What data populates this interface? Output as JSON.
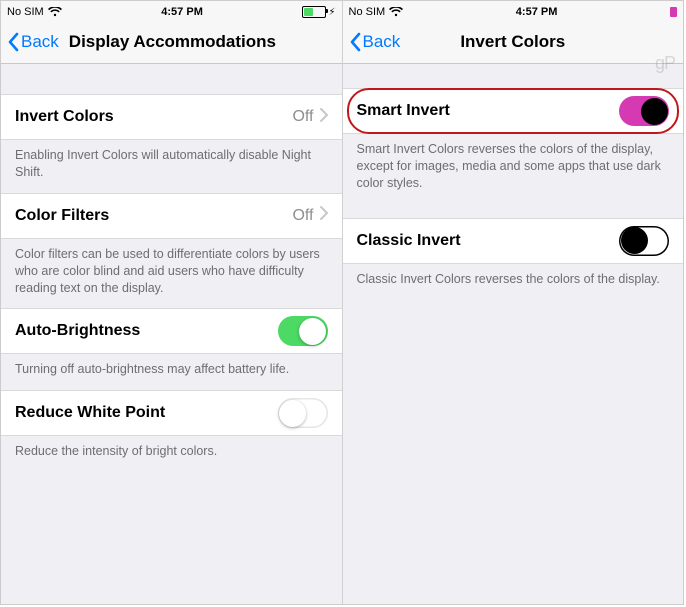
{
  "left": {
    "status": {
      "carrier": "No SIM",
      "time": "4:57 PM"
    },
    "nav": {
      "back": "Back",
      "title": "Display Accommodations"
    },
    "rows": {
      "invert": {
        "label": "Invert Colors",
        "value": "Off"
      },
      "invert_footer": "Enabling Invert Colors will automatically disable Night Shift.",
      "filters": {
        "label": "Color Filters",
        "value": "Off"
      },
      "filters_footer": "Color filters can be used to differentiate colors by users who are color blind and aid users who have difficulty reading text on the display.",
      "autobright": {
        "label": "Auto-Brightness"
      },
      "autobright_footer": "Turning off auto-brightness may affect battery life.",
      "whitepoint": {
        "label": "Reduce White Point"
      },
      "whitepoint_footer": "Reduce the intensity of bright colors."
    }
  },
  "right": {
    "status": {
      "carrier": "No SIM",
      "time": "4:57 PM"
    },
    "nav": {
      "back": "Back",
      "title": "Invert Colors"
    },
    "rows": {
      "smart": {
        "label": "Smart Invert"
      },
      "smart_footer": "Smart Invert Colors reverses the colors of the display, except for images, media and some apps that use dark color styles.",
      "classic": {
        "label": "Classic Invert"
      },
      "classic_footer": "Classic Invert Colors reverses the colors of the display."
    },
    "watermark": "gP"
  },
  "colors": {
    "toggle_on_green": "#4cd964",
    "toggle_on_magenta": "#d63ab3",
    "accent_magenta_square": "#d63ab3"
  }
}
